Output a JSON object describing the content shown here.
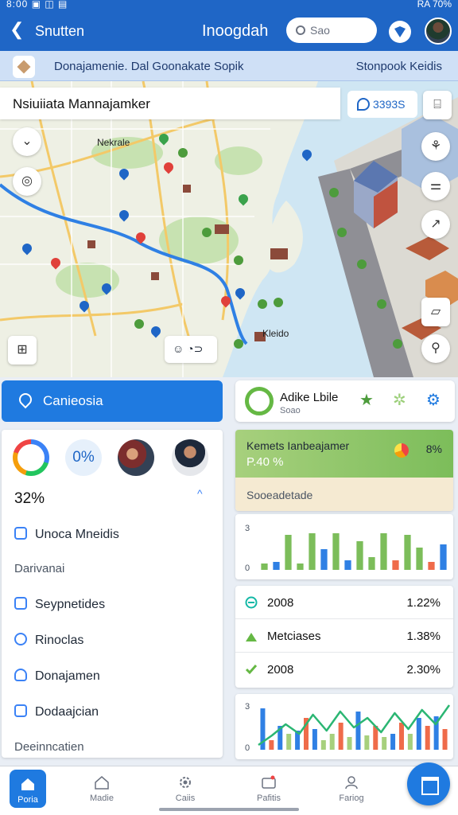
{
  "status_bar": {
    "left": "8:00 ▣ ◫ ▤",
    "right": "RA 70%"
  },
  "header": {
    "back_label": "Snutten",
    "title": "Inoogdah",
    "search_placeholder": "Sao"
  },
  "notice": {
    "left": "Donajamenie. Dal Goonakate Sopik",
    "right": "Stonpook Keidis"
  },
  "map": {
    "title": "Nsiuiiata Mannajamker",
    "badge": "3393S",
    "label_top": "Nekrale",
    "label_bottom": "Kleido",
    "float_bar": "☺ ◔⊃"
  },
  "location_button": {
    "label": "Canieosia"
  },
  "left_card": {
    "circle_text": "0%",
    "percent": "32%",
    "rows": [
      {
        "label": "Unoca Mneidis",
        "icon": "chat-icon"
      },
      {
        "label": "Darivanai",
        "type": "section"
      },
      {
        "label": "Seypnetides",
        "icon": "document-icon"
      },
      {
        "label": "Rinoclas",
        "icon": "pin-icon"
      },
      {
        "label": "Donajamen",
        "icon": "shield-icon"
      },
      {
        "label": "Dodaajcian",
        "icon": "folder-icon"
      },
      {
        "label": "Deeinncatien",
        "type": "section"
      }
    ]
  },
  "right_header": {
    "title": "Adike Lbile",
    "subtitle": "Soao"
  },
  "green_card": {
    "title": "Kemets Ianbeajamer",
    "value": "P.40 %",
    "percent": "8%",
    "footer": "Sooeadetade"
  },
  "stats": [
    {
      "label": "2008",
      "value": "1.22%",
      "icon": "minus-circle-icon",
      "color": "#14b8a6"
    },
    {
      "label": "Metciases",
      "value": "1.38%",
      "icon": "bar-icon",
      "color": "#65b844"
    },
    {
      "label": "2008",
      "value": "2.30%",
      "icon": "check-icon",
      "color": "#65b844"
    }
  ],
  "chart_data": [
    {
      "type": "bar",
      "ylim": [
        0,
        3
      ],
      "tick_labels": [
        "3",
        "0"
      ],
      "values": [
        0.4,
        0.5,
        2.2,
        0.4,
        2.3,
        1.3,
        2.3,
        0.6,
        1.8,
        0.8,
        2.3,
        0.6,
        2.2,
        1.4,
        0.5,
        1.6
      ],
      "colors": [
        "#7cbd5a",
        "#2f80e4",
        "#7cbd5a",
        "#7cbd5a",
        "#7cbd5a",
        "#2f80e4",
        "#7cbd5a",
        "#2f80e4",
        "#7cbd5a",
        "#7cbd5a",
        "#7cbd5a",
        "#ef6b4a",
        "#7cbd5a",
        "#7cbd5a",
        "#ef6b4a",
        "#2f80e4"
      ]
    },
    {
      "type": "bar",
      "ylim": [
        0,
        3
      ],
      "tick_labels": [
        "3",
        "0"
      ],
      "values": [
        2.6,
        0.6,
        1.5,
        1.0,
        1.2,
        2.0,
        1.3,
        0.6,
        1.0,
        1.7,
        0.8,
        2.4,
        0.9,
        1.5,
        0.8,
        1.0,
        1.7,
        1.0,
        2.0,
        1.5,
        2.1,
        1.3
      ],
      "colors": [
        "#2f80e4",
        "#ef6b4a",
        "#2f80e4",
        "#a7d07d",
        "#2f80e4",
        "#ef6b4a",
        "#2f80e4",
        "#a7d07d",
        "#a7d07d",
        "#ef6b4a",
        "#a7d07d",
        "#2f80e4",
        "#a7d07d",
        "#ef6b4a",
        "#a7d07d",
        "#2f80e4",
        "#ef6b4a",
        "#a7d07d",
        "#2f80e4",
        "#ef6b4a",
        "#2f80e4",
        "#ef6b4a"
      ],
      "trend": [
        0.3,
        0.9,
        1.6,
        1.0,
        2.2,
        1.2,
        2.4,
        1.4,
        2.0,
        1.1,
        2.3,
        1.3,
        2.5,
        1.6,
        2.8
      ],
      "trend_color": "#2bb673"
    }
  ],
  "bottom_nav": [
    {
      "label": "Poria",
      "icon": "home-icon",
      "active": true
    },
    {
      "label": "Madie",
      "icon": "house-outline-icon"
    },
    {
      "label": "Caiis",
      "icon": "gear-icon"
    },
    {
      "label": "Pafitis",
      "icon": "camera-icon"
    },
    {
      "label": "Fariog",
      "icon": "user-icon"
    }
  ],
  "colors": {
    "primary": "#1f66c6",
    "accent": "#1f7ae0",
    "green": "#65b844"
  }
}
